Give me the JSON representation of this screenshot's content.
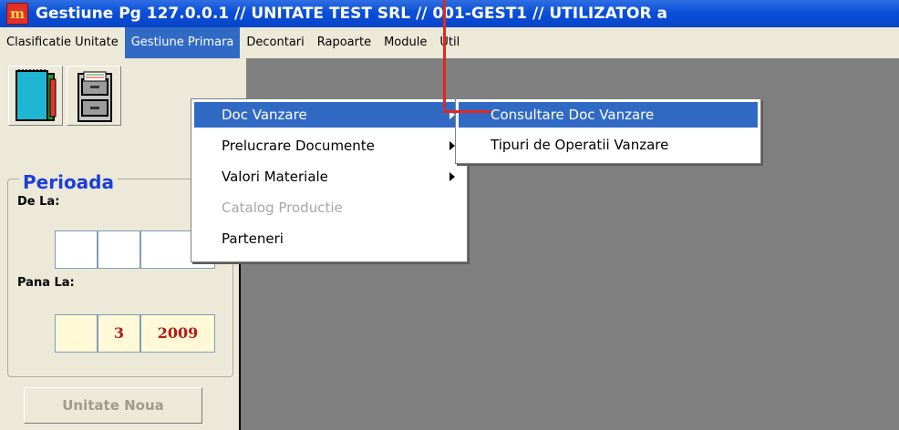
{
  "window": {
    "title": "Gestiune Pg 127.0.0.1 // UNITATE TEST SRL // 001-GEST1 // UTILIZATOR a",
    "app_icon_text": "m"
  },
  "menubar": {
    "items": [
      {
        "label": "Clasificatie Unitate"
      },
      {
        "label": "Gestiune Primara"
      },
      {
        "label": "Decontari"
      },
      {
        "label": "Rapoarte"
      },
      {
        "label": "Module"
      },
      {
        "label": "Util"
      }
    ]
  },
  "gestiune_menu": {
    "items": [
      {
        "label": "Doc Vanzare"
      },
      {
        "label": "Prelucrare Documente"
      },
      {
        "label": "Valori Materiale"
      },
      {
        "label": "Catalog Productie"
      },
      {
        "label": "Parteneri"
      }
    ]
  },
  "doc_vanzare_submenu": {
    "items": [
      {
        "label": "Consultare Doc Vanzare"
      },
      {
        "label": "Tipuri de Operatii Vanzare"
      }
    ]
  },
  "left_panel": {
    "group_title": "Perioada",
    "de_la_label": "De La:",
    "pana_la_label": "Pana La:",
    "pana_la_month": "3",
    "pana_la_year": "2009",
    "unitate_noua_button": "Unitate Noua"
  },
  "colors": {
    "accent": "#316ac5",
    "title_bar": "#0a4fd8",
    "pointer": "#e2271f",
    "date_text": "#b41a1a"
  }
}
